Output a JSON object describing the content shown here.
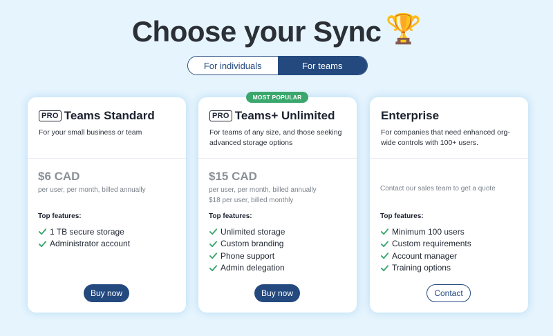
{
  "header": {
    "title": "Choose your Sync",
    "trophy_icon": "🏆"
  },
  "toggle": {
    "individuals_label": "For individuals",
    "teams_label": "For teams",
    "selected": "For teams"
  },
  "badges": {
    "most_popular": "MOST POPULAR",
    "pro": "PRO"
  },
  "colors": {
    "primary": "#24497f",
    "accent_green": "#3aa76d",
    "background": "#e6f4fd"
  },
  "plans": [
    {
      "name": "Teams Standard",
      "description": "For your small business or team",
      "price": "$6 CAD",
      "billing_lines": [
        "per user, per month, billed annually"
      ],
      "features_label": "Top features:",
      "features": [
        "1 TB secure storage",
        "Administrator account"
      ],
      "cta": "Buy now"
    },
    {
      "name": "Teams+ Unlimited",
      "description": "For teams of any size, and those seeking advanced storage options",
      "price": "$15 CAD",
      "billing_lines": [
        "per user, per month, billed annually",
        "$18 per user, billed monthly"
      ],
      "features_label": "Top features:",
      "features": [
        "Unlimited storage",
        "Custom branding",
        "Phone support",
        "Admin delegation"
      ],
      "cta": "Buy now"
    },
    {
      "name": "Enterprise",
      "description": "For companies that need enhanced org-wide controls with 100+ users.",
      "contact_note": "Contact our sales team to get a quote",
      "features_label": "Top features:",
      "features": [
        "Minimum 100 users",
        "Custom requirements",
        "Account manager",
        "Training options"
      ],
      "cta": "Contact"
    }
  ]
}
